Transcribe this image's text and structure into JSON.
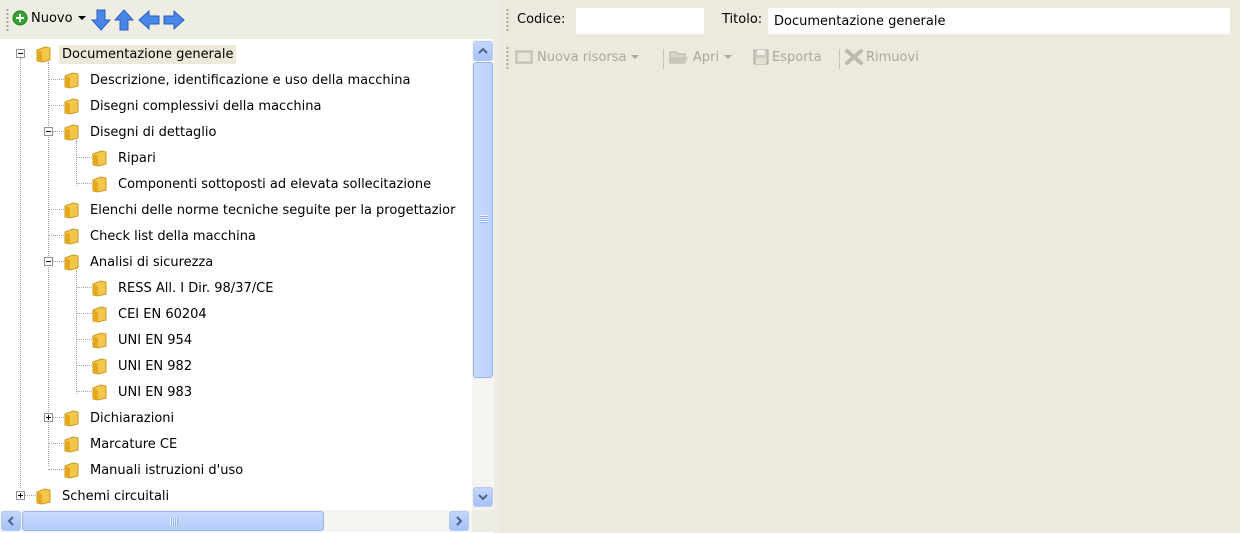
{
  "left_toolbar": {
    "new_label": "Nuovo"
  },
  "tree": {
    "nodes": [
      {
        "label": "Documentazione generale",
        "expander": "minus",
        "selected": true
      },
      {
        "label": "Descrizione, identificazione e uso della macchina"
      },
      {
        "label": "Disegni complessivi della macchina"
      },
      {
        "label": "Disegni di dettaglio",
        "expander": "minus"
      },
      {
        "label": "Ripari"
      },
      {
        "label": "Componenti sottoposti ad elevata sollecitazione"
      },
      {
        "label": "Elenchi delle norme tecniche seguite per la progettazior"
      },
      {
        "label": "Check list della macchina"
      },
      {
        "label": "Analisi di sicurezza",
        "expander": "minus"
      },
      {
        "label": "RESS All. I Dir. 98/37/CE"
      },
      {
        "label": "CEI EN 60204"
      },
      {
        "label": "UNI EN 954"
      },
      {
        "label": "UNI EN 982"
      },
      {
        "label": "UNI EN 983"
      },
      {
        "label": "Dichiarazioni",
        "expander": "plus"
      },
      {
        "label": "Marcature CE"
      },
      {
        "label": "Manuali istruzioni d'uso"
      },
      {
        "label": "Schemi circuitali",
        "expander": "plus"
      }
    ]
  },
  "header": {
    "code_label": "Codice:",
    "code_value": "",
    "title_label": "Titolo:",
    "title_value": "Documentazione generale"
  },
  "resource_toolbar": {
    "new_resource": "Nuova risorsa",
    "open": "Apri",
    "export": "Esporta",
    "remove": "Rimuovi"
  },
  "colors": {
    "toolbar_bg": "#eeede4",
    "panel_bg": "#eceade",
    "arrow_blue": "#4a86e8",
    "folder_yellow": "#f4c64a",
    "disabled_text": "#aca899",
    "scroll_blue": "#c1d3fb"
  },
  "icons": [
    "add-circle-icon",
    "arrow-down-icon",
    "arrow-up-icon",
    "arrow-left-icon",
    "arrow-right-icon",
    "folder-icon",
    "new-resource-icon",
    "open-folder-icon",
    "save-icon",
    "remove-x-icon"
  ]
}
